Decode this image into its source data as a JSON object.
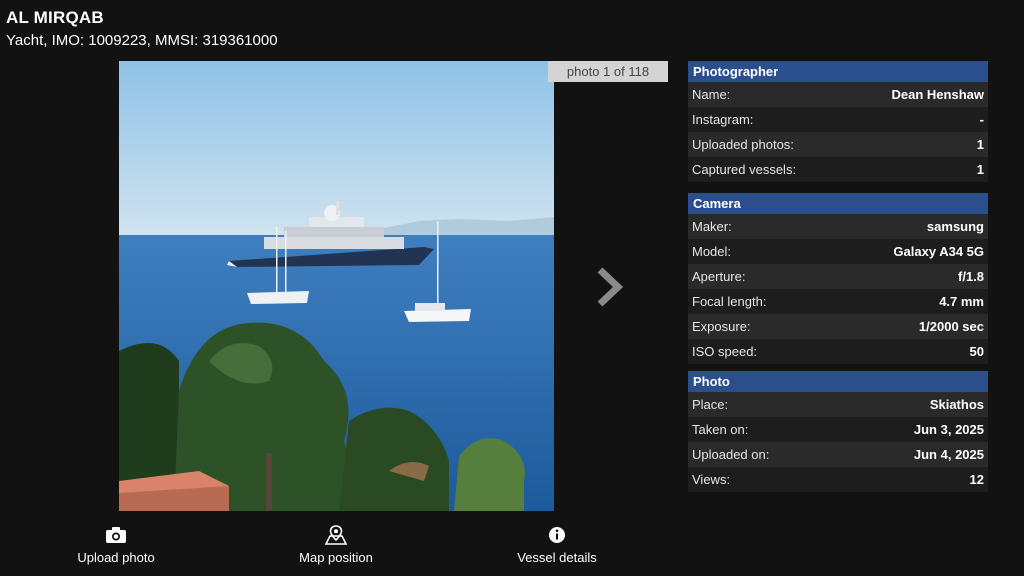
{
  "vessel": {
    "name": "AL MIRQAB",
    "subtitle": "Yacht, IMO: 1009223, MMSI: 319361000"
  },
  "photo": {
    "counter": "photo 1 of 118",
    "progress_fraction": 0.0085
  },
  "panels": {
    "photographer": {
      "title": "Photographer",
      "rows": [
        {
          "key": "Name:",
          "value": "Dean Henshaw"
        },
        {
          "key": "Instagram:",
          "value": "-"
        },
        {
          "key": "Uploaded photos:",
          "value": "1"
        },
        {
          "key": "Captured vessels:",
          "value": "1"
        }
      ]
    },
    "camera": {
      "title": "Camera",
      "rows": [
        {
          "key": "Maker:",
          "value": "samsung"
        },
        {
          "key": "Model:",
          "value": "Galaxy A34 5G"
        },
        {
          "key": "Aperture:",
          "value": "f/1.8"
        },
        {
          "key": "Focal length:",
          "value": "4.7 mm"
        },
        {
          "key": "Exposure:",
          "value": "1/2000 sec"
        },
        {
          "key": "ISO speed:",
          "value": "50"
        }
      ]
    },
    "photo": {
      "title": "Photo",
      "rows": [
        {
          "key": "Place:",
          "value": "Skiathos"
        },
        {
          "key": "Taken on:",
          "value": "Jun 3, 2025"
        },
        {
          "key": "Uploaded on:",
          "value": "Jun 4, 2025"
        },
        {
          "key": "Views:",
          "value": "12"
        }
      ]
    }
  },
  "actions": [
    {
      "label": "Upload photo",
      "icon": "camera-icon"
    },
    {
      "label": "Map position",
      "icon": "map-pin-icon"
    },
    {
      "label": "Vessel details",
      "icon": "info-icon"
    }
  ],
  "colors": {
    "background": "#121212",
    "panel_header": "#2b4f8d",
    "row_odd": "#2a2a2a",
    "row_even": "#1d1d1d",
    "counter_bg": "#d4d4d4"
  }
}
